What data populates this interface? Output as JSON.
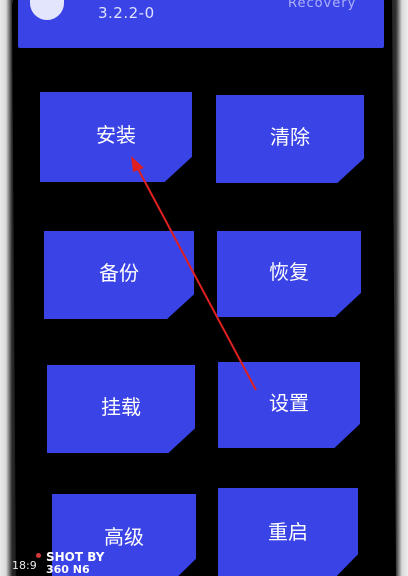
{
  "header": {
    "partial_title": "Recovery",
    "version": "3.2.2-0"
  },
  "buttons": {
    "install": "安装",
    "wipe": "清除",
    "backup": "备份",
    "restore": "恢复",
    "mount": "挂载",
    "settings": "设置",
    "advanced": "高级",
    "reboot": "重启"
  },
  "watermark": {
    "time": "18:9",
    "shot_by": "SHOT BY",
    "model": "360 N6"
  },
  "colors": {
    "tile_blue": "#3a43e6",
    "arrow_red": "#e02020"
  }
}
